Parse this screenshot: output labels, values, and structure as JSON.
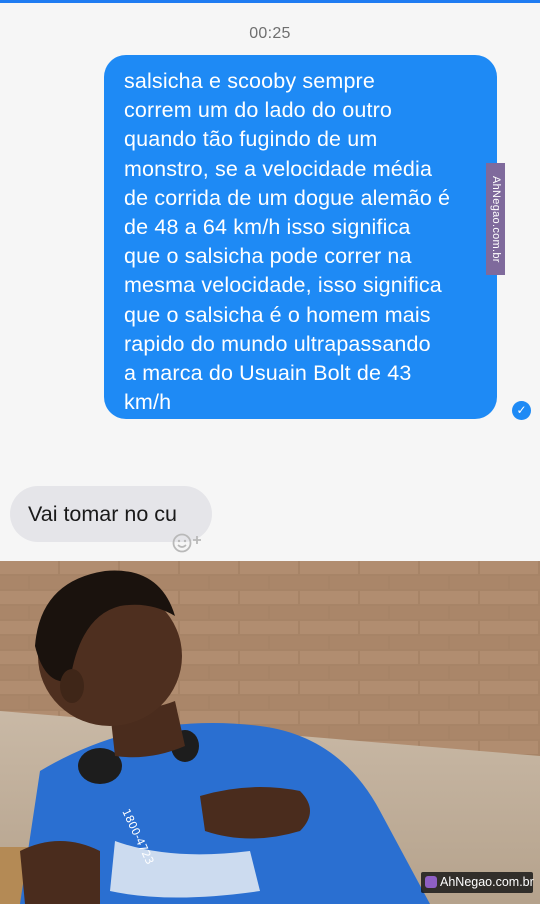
{
  "chat": {
    "timestamp": "00:25",
    "outgoing_message": "salsicha e scooby sempre\ncorrem um do lado do outro\nquando tão fugindo de um\nmonstro, se a velocidade média\nde corrida de um dogue alemão é\nde 48 a 64 km/h isso significa\nque o salsicha pode correr na\nmesma velocidade, isso significa\nque o salsicha é o homem mais\nrapido do mundo ultrapassando\na marca do Usuain Bolt de 43\nkm/h",
    "incoming_message": "Vai tomar no cu",
    "seen_icon": "check-circle-icon",
    "react_icon": "smiley-add-icon"
  },
  "watermarks": {
    "side": "AhNegao.com.br",
    "bottom": "AhNegao.com.br"
  },
  "photo": {
    "shirt_text": "1800-4723"
  },
  "colors": {
    "accent": "#1e8af5",
    "incoming_bubble": "#e5e5e9",
    "chat_background": "#f6f6f6",
    "watermark": "#7f6a9c"
  }
}
